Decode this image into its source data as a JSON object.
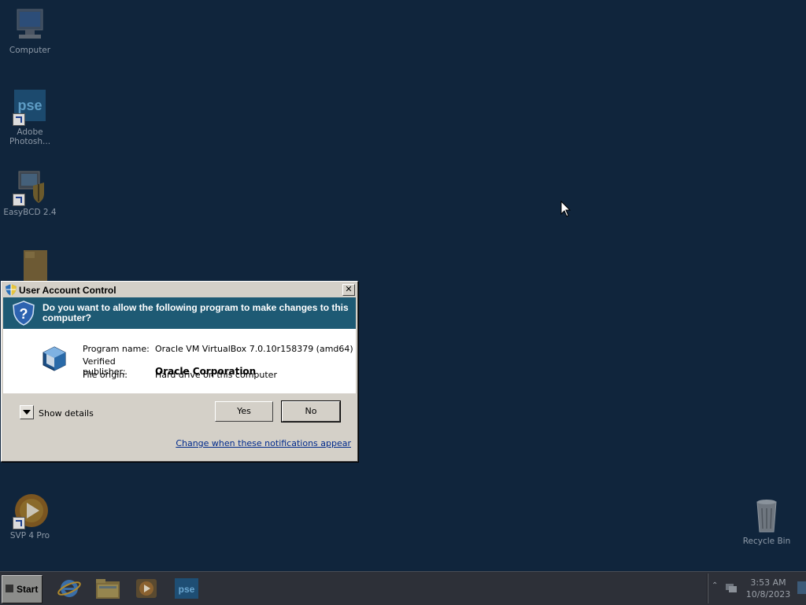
{
  "desktop": {
    "icons": [
      {
        "label": "Computer"
      },
      {
        "label": "Adobe Photosh..."
      },
      {
        "label": "EasyBCD 2.4"
      },
      {
        "label": ""
      },
      {
        "label": "SVP 4 Pro"
      },
      {
        "label": "Recycle Bin"
      }
    ]
  },
  "uac": {
    "title": "User Account Control",
    "question": "Do you want to allow the following program to make changes to this computer?",
    "fields": [
      {
        "key": "Program name:",
        "value": "Oracle VM VirtualBox 7.0.10r158379 (amd64)"
      },
      {
        "key": "Verified publisher:",
        "value": "Oracle Corporation"
      },
      {
        "key": "File origin:",
        "value": "Hard drive on this computer"
      }
    ],
    "show_details": "Show details",
    "yes": "Yes",
    "no": "No",
    "change_link": "Change when these notifications appear",
    "close_glyph": "✕"
  },
  "taskbar": {
    "start_label": "Start",
    "apps": [
      "internet-explorer-icon",
      "file-explorer-icon",
      "media-player-icon",
      "photoshop-elements-icon"
    ],
    "clock_time": "3:53 AM",
    "clock_date": "10/8/2023"
  },
  "colors": {
    "desktop_bg": "#10253c",
    "banner_bg": "#1e5a74",
    "dialog_bg": "#d4d0c8",
    "link": "#002a8c"
  }
}
